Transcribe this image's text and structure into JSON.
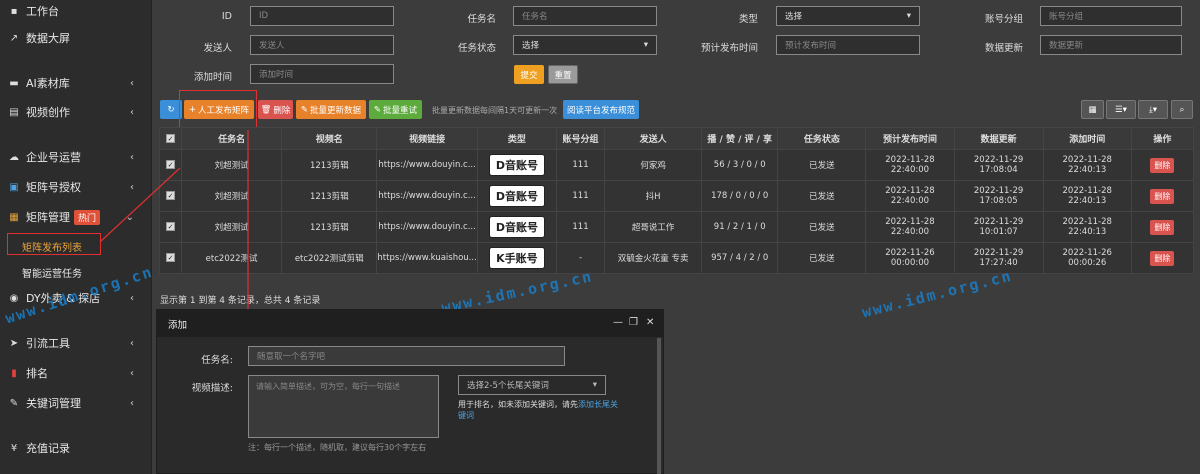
{
  "sidebar": {
    "items": [
      {
        "label": "工作台",
        "icon": "home-icon",
        "glyph": "▪"
      },
      {
        "label": "数据大屏",
        "icon": "chart-line-icon",
        "glyph": "↗"
      },
      {
        "label": "AI素材库",
        "icon": "folder-icon",
        "glyph": "▬"
      },
      {
        "label": "视频创作",
        "icon": "film-icon",
        "glyph": "▤"
      },
      {
        "label": "企业号运营",
        "icon": "cloud-icon",
        "glyph": "☁"
      },
      {
        "label": "矩阵号授权",
        "icon": "matrix-icon",
        "glyph": "▣"
      },
      {
        "label": "矩阵管理",
        "icon": "matrix-manage-icon",
        "glyph": "▦"
      },
      {
        "label": "DY外卖 & 探店",
        "icon": "globe-icon",
        "glyph": "◉"
      },
      {
        "label": "引流工具",
        "icon": "send-icon",
        "glyph": "➤"
      },
      {
        "label": "排名",
        "icon": "ranking-icon",
        "glyph": "▮"
      },
      {
        "label": "关键词管理",
        "icon": "edit-icon",
        "glyph": "✎"
      },
      {
        "label": "充值记录",
        "icon": "yen-icon",
        "glyph": "¥"
      }
    ],
    "hot_badge": "热门",
    "sub_items": [
      "矩阵发布列表",
      "智能运营任务"
    ]
  },
  "filters": {
    "id_label": "ID",
    "id_placeholder": "ID",
    "task_name_label": "任务名",
    "task_name_placeholder": "任务名",
    "type_label": "类型",
    "type_value": "选择",
    "account_group_label": "账号分组",
    "account_group_placeholder": "账号分组",
    "sender_label": "发送人",
    "sender_placeholder": "发送人",
    "task_status_label": "任务状态",
    "task_status_value": "选择",
    "scheduled_label": "预计发布时间",
    "scheduled_placeholder": "预计发布时间",
    "data_update_label": "数据更新",
    "data_update_placeholder": "数据更新",
    "added_time_label": "添加时间",
    "added_time_placeholder": "添加时间",
    "submit": "提交",
    "reset": "重置"
  },
  "toolbar": {
    "manual_publish": "人工发布矩阵",
    "delete": "删除",
    "batch_update": "批量更新数据",
    "batch_retry": "批量重试",
    "note": "批量更新数据每间隔1天可更新一次",
    "read_rules": "阅读平台发布规范"
  },
  "table": {
    "headers": [
      "任务名",
      "视频名",
      "视频链接",
      "类型",
      "账号分组",
      "发送人",
      "播 / 赞 / 评 / 享",
      "任务状态",
      "预计发布时间",
      "数据更新",
      "添加时间",
      "操作"
    ],
    "rows": [
      {
        "task": "刘超测试",
        "video": "1213剪辑",
        "url": "https://www.douyin.c...",
        "type": "D音账号",
        "group": "111",
        "sender": "何家鸡",
        "stats": "56 / 3 / 0 / 0",
        "status": "已发送",
        "scheduled": "2022-11-28 22:40:00",
        "updated": "2022-11-29 17:08:04",
        "added": "2022-11-28 22:40:13",
        "op": "删除"
      },
      {
        "task": "刘超测试",
        "video": "1213剪辑",
        "url": "https://www.douyin.c...",
        "type": "D音账号",
        "group": "111",
        "sender": "抖H",
        "stats": "178 / 0 / 0 / 0",
        "status": "已发送",
        "scheduled": "2022-11-28 22:40:00",
        "updated": "2022-11-29 17:08:05",
        "added": "2022-11-28 22:40:13",
        "op": "删除"
      },
      {
        "task": "刘超测试",
        "video": "1213剪辑",
        "url": "https://www.douyin.c...",
        "type": "D音账号",
        "group": "111",
        "sender": "超哥说工作",
        "stats": "91 / 2 / 1 / 0",
        "status": "已发送",
        "scheduled": "2022-11-28 22:40:00",
        "updated": "2022-11-29 10:01:07",
        "added": "2022-11-28 22:40:13",
        "op": "删除"
      },
      {
        "task": "etc2022测试",
        "video": "etc2022测试剪辑",
        "url": "https://www.kuaishou...",
        "type": "K手账号",
        "group": "-",
        "sender": "双毓金火花童 专卖",
        "stats": "957 / 4 / 2 / 0",
        "status": "已发送",
        "scheduled": "2022-11-26 00:00:00",
        "updated": "2022-11-29 17:27:40",
        "added": "2022-11-26 00:00:26",
        "op": "删除"
      }
    ],
    "footer": "显示第 1 到第 4 条记录，总共 4 条记录"
  },
  "modal": {
    "title": "添加",
    "task_name_label": "任务名:",
    "task_name_placeholder": "随意取一个名字吧",
    "video_desc_label": "视频描述:",
    "video_desc_placeholder": "请输入简单描述，可为空，每行一句描述",
    "keyword_select": "选择2-5个长尾关键词",
    "keyword_help": "用于排名，如未添加关键词，请先",
    "keyword_help_link": "添加长尾关键词",
    "desc_note": "注：每行一个描述，随机取，建议每行30个字左右"
  },
  "watermark": "www.idm.org.cn"
}
